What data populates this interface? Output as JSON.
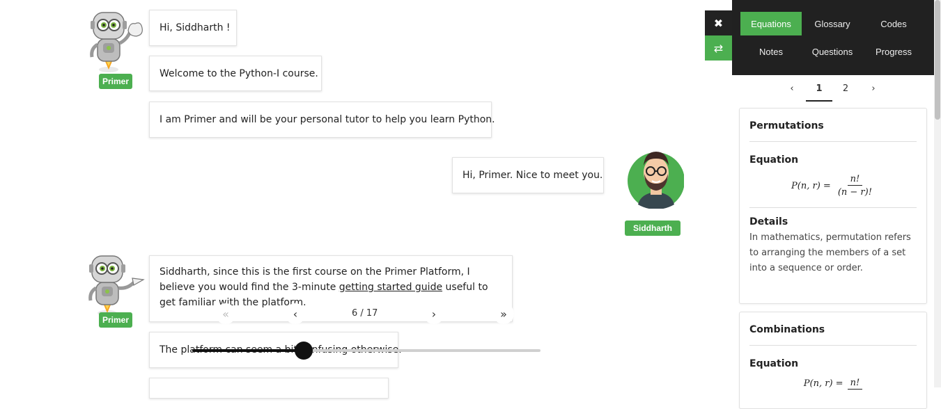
{
  "chat": {
    "messages": [
      {
        "text": "Hi, Siddharth !"
      },
      {
        "text": "Welcome to the Python-I course."
      },
      {
        "text": "I am Primer and will be your personal tutor to help you learn Python."
      },
      {
        "text": "Hi, Primer. Nice to meet you."
      },
      {
        "text_before": "Siddharth, since this is the first course on the Primer Platform, I believe you would find the 3-minute ",
        "link": "getting started guide",
        "text_after": " useful to get familiar with the platform."
      },
      {
        "text": "The platform can seem a bit confusing otherwise."
      }
    ],
    "bot_name": "Primer",
    "user_name": "Siddharth"
  },
  "player": {
    "counter": "6 / 17",
    "progress": 0.32,
    "icons": [
      "double-chevron-left-icon",
      "chevron-left-icon",
      "chevron-right-icon",
      "double-chevron-right-icon"
    ]
  },
  "side_tools": {
    "close_icon": "✖",
    "swap_icon": "⇄"
  },
  "panel": {
    "tabs": [
      "Equations",
      "Glossary",
      "Codes",
      "Notes",
      "Questions",
      "Progress"
    ],
    "active_tab": "Equations",
    "pager": {
      "prev": "‹",
      "pages": [
        "1",
        "2"
      ],
      "next": "›",
      "active": "1"
    },
    "cards": [
      {
        "title": "Permutations",
        "equation_label": "Equation",
        "equation_lhs": "P(n, r) =",
        "equation_num": "n!",
        "equation_den": "(n − r)!",
        "details_label": "Details",
        "details": "In mathematics, permutation refers to arranging the members of a set into a sequence or order."
      },
      {
        "title": "Combinations",
        "equation_label": "Equation",
        "equation_lhs": "P(n, r) =",
        "equation_num": "n!"
      }
    ]
  },
  "colors": {
    "accent": "#4caf50",
    "panel_header": "#212121"
  }
}
